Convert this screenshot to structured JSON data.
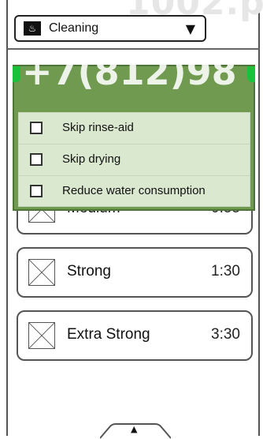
{
  "header": {
    "mode_label": "Cleaning",
    "mode_icon": "dishwasher-icon"
  },
  "watermark": {
    "phone": "+7(812)98",
    "top_fragment": "1002.p"
  },
  "options": [
    {
      "label": "Skip rinse-aid",
      "checked": false
    },
    {
      "label": "Skip drying",
      "checked": false
    },
    {
      "label": "Reduce water consumption",
      "checked": false
    }
  ],
  "programs": [
    {
      "name": "Medium",
      "time": "0:55"
    },
    {
      "name": "Strong",
      "time": "1:30"
    },
    {
      "name": "Extra Strong",
      "time": "3:30"
    }
  ],
  "colors": {
    "popup_green": "#6f9a4f",
    "accent_green": "#19c23a",
    "option_bg": "#d9e8cf"
  }
}
